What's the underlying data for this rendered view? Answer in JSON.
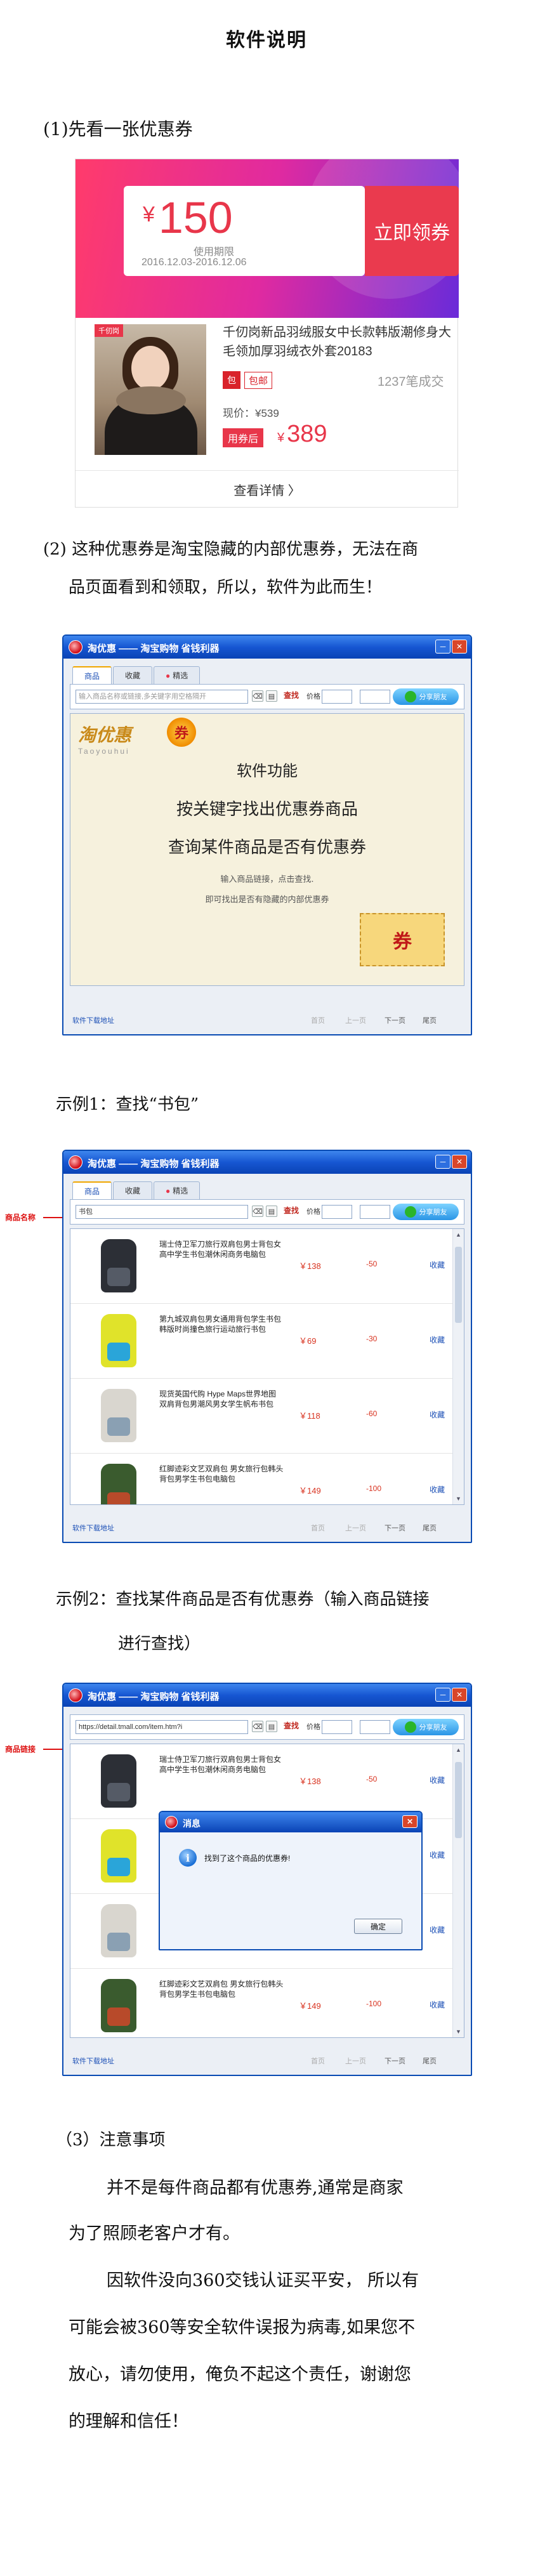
{
  "page_title": "软件说明",
  "section1": {
    "heading": "(1)先看一张优惠券"
  },
  "coupon": {
    "yen": "¥",
    "amount": "150",
    "period_label": "使用期限",
    "period": "2016.12.03-2016.12.06",
    "claim_label": "立即领券",
    "product_tag": "千仞岗",
    "product_title": "千仞岗新品羽绒服女中长款韩版潮修身大毛领加厚羽绒衣外套20183",
    "baoyou_icon": "包",
    "baoyou_label": "包邮",
    "sales": "1237笔成交",
    "current_price": "现价：¥539",
    "after_label": "用券后",
    "after_price": "389",
    "details_label": "查看详情 〉"
  },
  "section2": {
    "line1": "(2) 这种优惠券是淘宝隐藏的内部优惠券，无法在商",
    "line2": "品页面看到和领取，所以，软件为此而生！"
  },
  "app": {
    "title": "淘优惠 —— 淘宝购物 省钱利器",
    "tabs": [
      "商品",
      "收藏",
      "精选"
    ],
    "search_placeholder": "输入商品名称或链接,多关键字用空格隔开",
    "search_button": "查找",
    "price_label": "价格",
    "share_label": "分享朋友",
    "download_link": "软件下载地址",
    "pager": [
      "首页",
      "上一页",
      "下一页",
      "尾页"
    ]
  },
  "welcome": {
    "logo": "淘优惠",
    "logo_sub": "Taoyouhui",
    "logo_mark": "券",
    "line1": "软件功能",
    "line2": "按关键字找出优惠券商品",
    "line3": "查询某件商品是否有优惠券",
    "line4": "输入商品链接，点击查找.",
    "line5": "即可找出是否有隐藏的内部优惠券",
    "stamp": "券"
  },
  "example1": {
    "heading": "示例1：查找“书包”",
    "annotation": "商品名称",
    "search_value": "书包"
  },
  "example2": {
    "heading_line1": "示例2：查找某件商品是否有优惠券（输入商品链接",
    "heading_line2": "进行查找）",
    "annotation": "商品链接",
    "search_value": "https://detail.tmall.com/item.htm?i"
  },
  "products": [
    {
      "title": "瑞士侍卫军刀旅行双肩包男士背包女高中学生书包潮休闲商务电脑包",
      "price": "￥138",
      "coupon": "-50",
      "fav": "收藏",
      "color": "#2c2f36",
      "accent": "#555b66"
    },
    {
      "title": "第九城双肩包男女通用背包学生书包韩版时尚撞色旅行运动旅行书包",
      "price": "￥69",
      "coupon": "-30",
      "fav": "收藏",
      "color": "#e0e32a",
      "accent": "#2aa5d9"
    },
    {
      "title": "现货英国代购 Hype Maps世界地图双肩背包男潮风男女学生帆布书包",
      "price": "￥118",
      "coupon": "-60",
      "fav": "收藏",
      "color": "#d9d6cf",
      "accent": "#8aa0b3"
    },
    {
      "title": "红脚迹彩文艺双肩包 男女旅行包韩头背包男学生书包电脑包",
      "price": "￥149",
      "coupon": "-100",
      "fav": "收藏",
      "color": "#3a5b2e",
      "accent": "#b84a2a"
    }
  ],
  "dialog": {
    "title": "消息",
    "message": "找到了这个商品的优惠券!",
    "ok": "确定"
  },
  "notes": {
    "heading": "（3）注意事项",
    "lines": [
      "并不是每件商品都有优惠券,通常是商家",
      "为了照顾老客户才有。",
      "因软件没向360交钱认证买平安， 所以有",
      "可能会被360等安全软件误报为病毒,如果您不",
      "放心，请勿使用，俺负不起这个责任，谢谢您",
      "的理解和信任！"
    ]
  }
}
